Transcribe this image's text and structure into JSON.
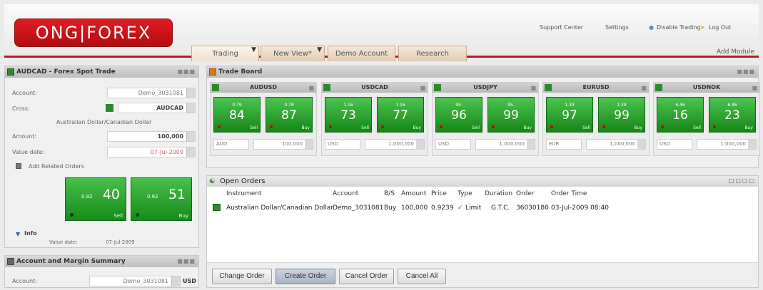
{
  "header": {
    "logo": "ONG|FOREX",
    "links": {
      "support": "Support Center",
      "settings": "Settings",
      "disable": "Disable Trading",
      "logout": "Log Out"
    },
    "add_module": "Add Module"
  },
  "tabs": [
    {
      "label": "Trading"
    },
    {
      "label": "New View*"
    },
    {
      "label": "Demo Account"
    },
    {
      "label": "Research"
    }
  ],
  "spot": {
    "title": "AUDCAD - Forex Spot Trade",
    "account_label": "Account:",
    "account_value": "Demo_3031081",
    "cross_label": "Cross:",
    "cross_value": "AUDCAD",
    "cross_desc": "Australian Dollar/Canadian Dollar",
    "amount_label": "Amount:",
    "amount_value": "100,000",
    "value_date_label": "Value date:",
    "value_date_value": "07-Jul-2009",
    "related_orders": "Add Related Orders",
    "sell": {
      "small": "0.92",
      "big": "40",
      "tag": "Sell"
    },
    "buy": {
      "small": "0.92",
      "big": "51",
      "tag": "Buy"
    },
    "info_label": "Info",
    "info_value_date_label": "Value date:",
    "info_value_date": "07-Jul-2009"
  },
  "summary": {
    "title": "Account and Margin Summary",
    "account_label": "Account:",
    "account_value": "Demo_3031081",
    "currency": "USD"
  },
  "tradeboard": {
    "title": "Trade Board",
    "tiles": [
      {
        "pair": "AUDUSD",
        "sell": {
          "small": "0.79",
          "big": "84"
        },
        "buy": {
          "small": "0.79",
          "big": "87"
        },
        "ccy": "AUD",
        "amount": "100,000"
      },
      {
        "pair": "USDCAD",
        "sell": {
          "small": "1.16",
          "big": "73"
        },
        "buy": {
          "small": "1.16",
          "big": "77"
        },
        "ccy": "USD",
        "amount": "1,000,000"
      },
      {
        "pair": "USDJPY",
        "sell": {
          "small": "95.",
          "big": "96"
        },
        "buy": {
          "small": "95.",
          "big": "99"
        },
        "ccy": "USD",
        "amount": "1,000,000"
      },
      {
        "pair": "EURUSD",
        "sell": {
          "small": "1.39",
          "big": "97"
        },
        "buy": {
          "small": "1.39",
          "big": "99"
        },
        "ccy": "EUR",
        "amount": "1,000,000"
      },
      {
        "pair": "USDNOK",
        "sell": {
          "small": "6.46",
          "big": "16"
        },
        "buy": {
          "small": "6.46",
          "big": "23"
        },
        "ccy": "USD",
        "amount": "1,000,000"
      }
    ],
    "sell_tag": "Sell",
    "buy_tag": "Buy"
  },
  "orders": {
    "title": "Open Orders",
    "columns": [
      "Instrument",
      "Account",
      "B/S",
      "Amount",
      "Price",
      "Type",
      "Duration",
      "Order",
      "Order Time"
    ],
    "rows": [
      [
        "Australian Dollar/Canadian Dollar",
        "Demo_3031081",
        "Buy",
        "100,000",
        "0.9239",
        "Limit",
        "G.T.C.",
        "36030180",
        "03-Jul-2009 08:40"
      ]
    ],
    "buttons": {
      "change": "Change Order",
      "create": "Create Order",
      "cancel": "Cancel Order",
      "cancel_all": "Cancel All"
    }
  },
  "colors": {
    "brand": "#c8141c",
    "price_green": "#2fa432"
  }
}
